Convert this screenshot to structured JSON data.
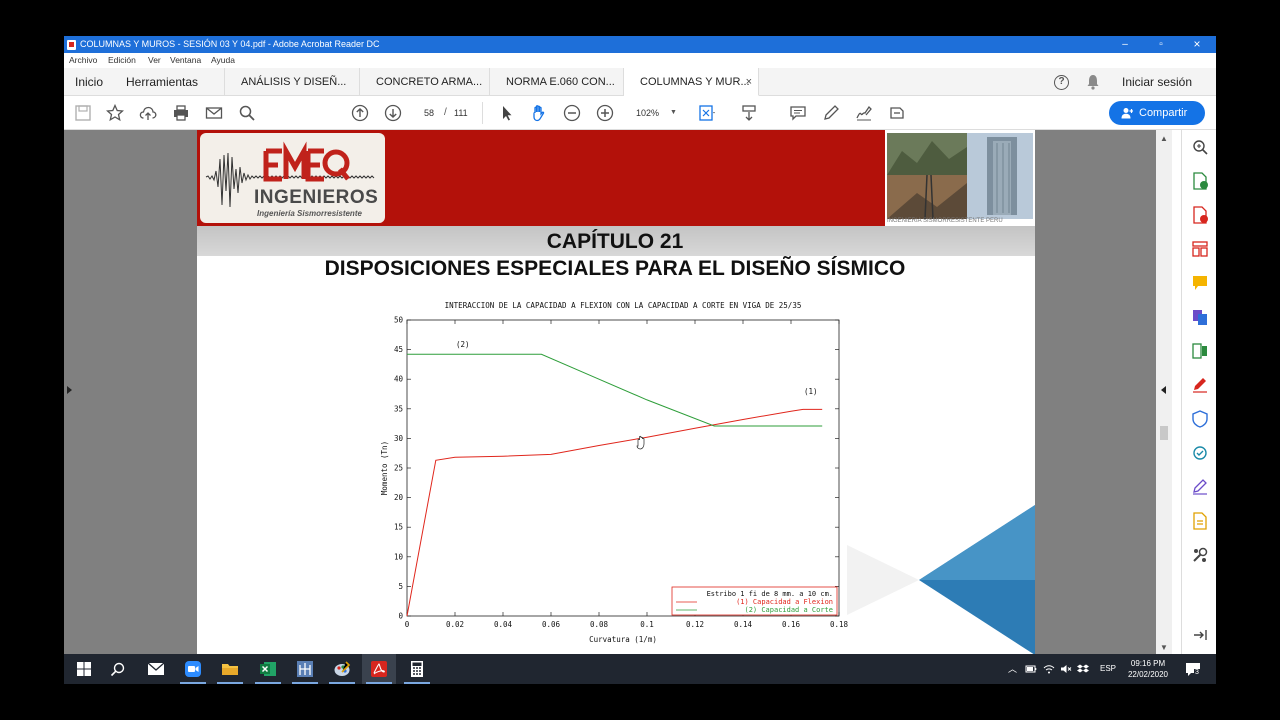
{
  "window": {
    "title": "COLUMNAS Y MUROS - SESIÓN 03 Y 04.pdf - Adobe Acrobat Reader DC",
    "minimize": "–",
    "maximize": "▫",
    "close": "×"
  },
  "menu": [
    "Archivo",
    "Edición",
    "Ver",
    "Ventana",
    "Ayuda"
  ],
  "tabs": {
    "home": "Inicio",
    "tools": "Herramientas",
    "documents": [
      {
        "label": "ANÁLISIS Y DISEÑ...",
        "active": false
      },
      {
        "label": "CONCRETO ARMA...",
        "active": false
      },
      {
        "label": "NORMA E.060 CON...",
        "active": false
      },
      {
        "label": "COLUMNAS Y MUR...",
        "active": true
      }
    ],
    "close_label": "×",
    "signin": "Iniciar sesión"
  },
  "toolbar": {
    "current_page": "58",
    "page_separator": "/",
    "total_pages": "111",
    "zoom": "102%",
    "share_label": "Compartir"
  },
  "page": {
    "logo_text": "INGENIEROS",
    "logo_subtitle": "Ingeniería Sismorresistente",
    "photo_caption": "INGENIERIA SISMORRESISTENTE PERU",
    "chapter": "CAPÍTULO 21",
    "subtitle": "DISPOSICIONES ESPECIALES PARA EL DISEÑO SÍSMICO"
  },
  "chart_data": {
    "type": "line",
    "title": "INTERACCION DE LA CAPACIDAD A FLEXION CON LA CAPACIDAD A CORTE EN VIGA DE 25/35",
    "xlabel": "Curvatura (1/m)",
    "ylabel": "Momento (Tn)",
    "xlim": [
      0,
      0.18
    ],
    "ylim": [
      0,
      50
    ],
    "xticks": [
      "0",
      "0.02",
      "0.04",
      "0.06",
      "0.08",
      "0.1",
      "0.12",
      "0.14",
      "0.16",
      "0.18"
    ],
    "yticks": [
      "0",
      "5",
      "10",
      "15",
      "20",
      "25",
      "30",
      "35",
      "40",
      "45",
      "50"
    ],
    "grid": false,
    "legend_position": "bottom-right",
    "legend_title": "Estribo 1 fi de 8 mm. a 10 cm.",
    "annotations": [
      "(1)",
      "(2)"
    ],
    "series": [
      {
        "name": "(1) Capacidad a Flexion",
        "color": "#e0261c",
        "x": [
          0,
          0.012,
          0.02,
          0.04,
          0.06,
          0.08,
          0.1,
          0.12,
          0.14,
          0.16,
          0.165,
          0.173
        ],
        "y": [
          0,
          26.3,
          26.8,
          27.0,
          27.3,
          28.8,
          30.2,
          31.7,
          33.2,
          34.6,
          34.9,
          34.9
        ]
      },
      {
        "name": "(2) Capacidad a Corte",
        "color": "#2e9e3a",
        "x": [
          0,
          0.056,
          0.08,
          0.1,
          0.128,
          0.173
        ],
        "y": [
          44.2,
          44.2,
          40.0,
          36.5,
          32.1,
          32.1
        ]
      }
    ]
  },
  "taskbar": {
    "language": "ESP",
    "time": "09:16 PM",
    "date": "22/02/2020",
    "notification_count": "3"
  }
}
